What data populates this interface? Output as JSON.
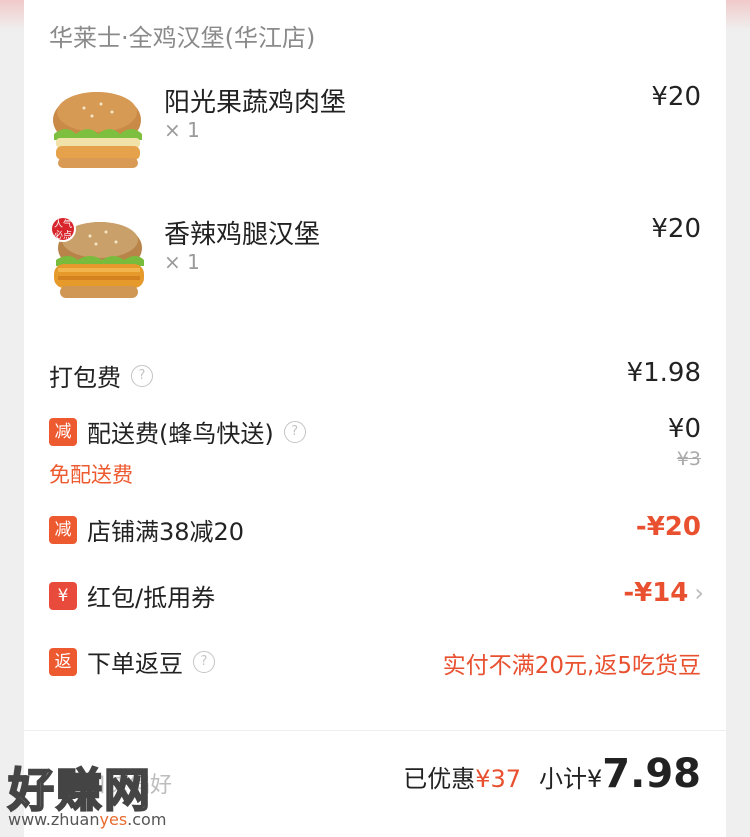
{
  "shop": {
    "name": "华莱士·全鸡汉堡(华江店)"
  },
  "items": [
    {
      "name": "阳光果蔬鸡肉堡",
      "qty": "× 1",
      "price": "¥20",
      "badge": ""
    },
    {
      "name": "香辣鸡腿汉堡",
      "qty": "× 1",
      "price": "¥20",
      "badge": "人气必点"
    }
  ],
  "fees": {
    "packing": {
      "label": "打包费",
      "value": "¥1.98"
    },
    "delivery": {
      "tag": "减",
      "label": "配送费(蜂鸟快送)",
      "value": "¥0",
      "original": "¥3",
      "note": "免配送费"
    },
    "shop_discount": {
      "tag": "减",
      "label": "店铺满38减20",
      "value": "-¥20"
    },
    "coupon": {
      "tag": "¥",
      "label": "红包/抵用券",
      "value": "-¥14"
    },
    "cashback": {
      "tag": "返",
      "label": "下单返豆",
      "value": "实付不满20元,返5吃货豆"
    }
  },
  "help_glyph": "?",
  "bottom": {
    "remark_partial": "口味偏好",
    "saved_label": "已优惠",
    "saved_value": "¥37",
    "subtotal_label": "小计¥",
    "subtotal_value": "7.98"
  },
  "watermark": {
    "text": "好赚网",
    "url_pre": "www.zhuan",
    "url_hl": "yes",
    "url_post": ".com"
  },
  "colors": {
    "accent": "#e8502f",
    "tag": "#ee5a2f"
  }
}
